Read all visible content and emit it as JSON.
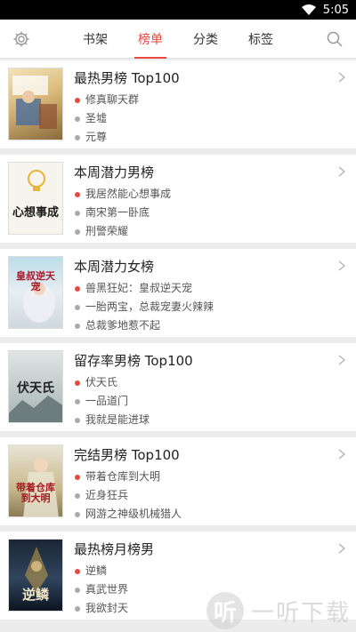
{
  "status_bar": {
    "time": "5:05"
  },
  "header": {
    "tabs": [
      {
        "label": "书架",
        "active": false
      },
      {
        "label": "榜单",
        "active": true
      },
      {
        "label": "分类",
        "active": false
      },
      {
        "label": "标签",
        "active": false
      }
    ],
    "accent_color": "#e8483e"
  },
  "rankings": [
    {
      "title": "最热男榜 Top100",
      "cover_text": "",
      "books": [
        "修真聊天群",
        "圣墟",
        "元尊"
      ]
    },
    {
      "title": "本周潜力男榜",
      "cover_text": "心想事成",
      "books": [
        "我居然能心想事成",
        "南宋第一卧底",
        "刑警荣耀"
      ]
    },
    {
      "title": "本周潜力女榜",
      "cover_text": "皇叔逆天宠",
      "books": [
        "兽黑狂妃：皇叔逆天宠",
        "一胎两宝，总裁宠妻火辣辣",
        "总裁爹地惹不起"
      ]
    },
    {
      "title": "留存率男榜 Top100",
      "cover_text": "伏天氏",
      "books": [
        "伏天氏",
        "一品道门",
        "我就是能进球"
      ]
    },
    {
      "title": "完结男榜 Top100",
      "cover_text": "带着仓库到大明",
      "books": [
        "带着仓库到大明",
        "近身狂兵",
        "网游之神级机械猎人"
      ]
    },
    {
      "title": "最热榜月榜男",
      "cover_text": "逆鳞",
      "books": [
        "逆鳞",
        "真武世界",
        "我欲封天"
      ]
    }
  ],
  "watermark": {
    "logo_glyph": "听",
    "text": "一听下载"
  }
}
